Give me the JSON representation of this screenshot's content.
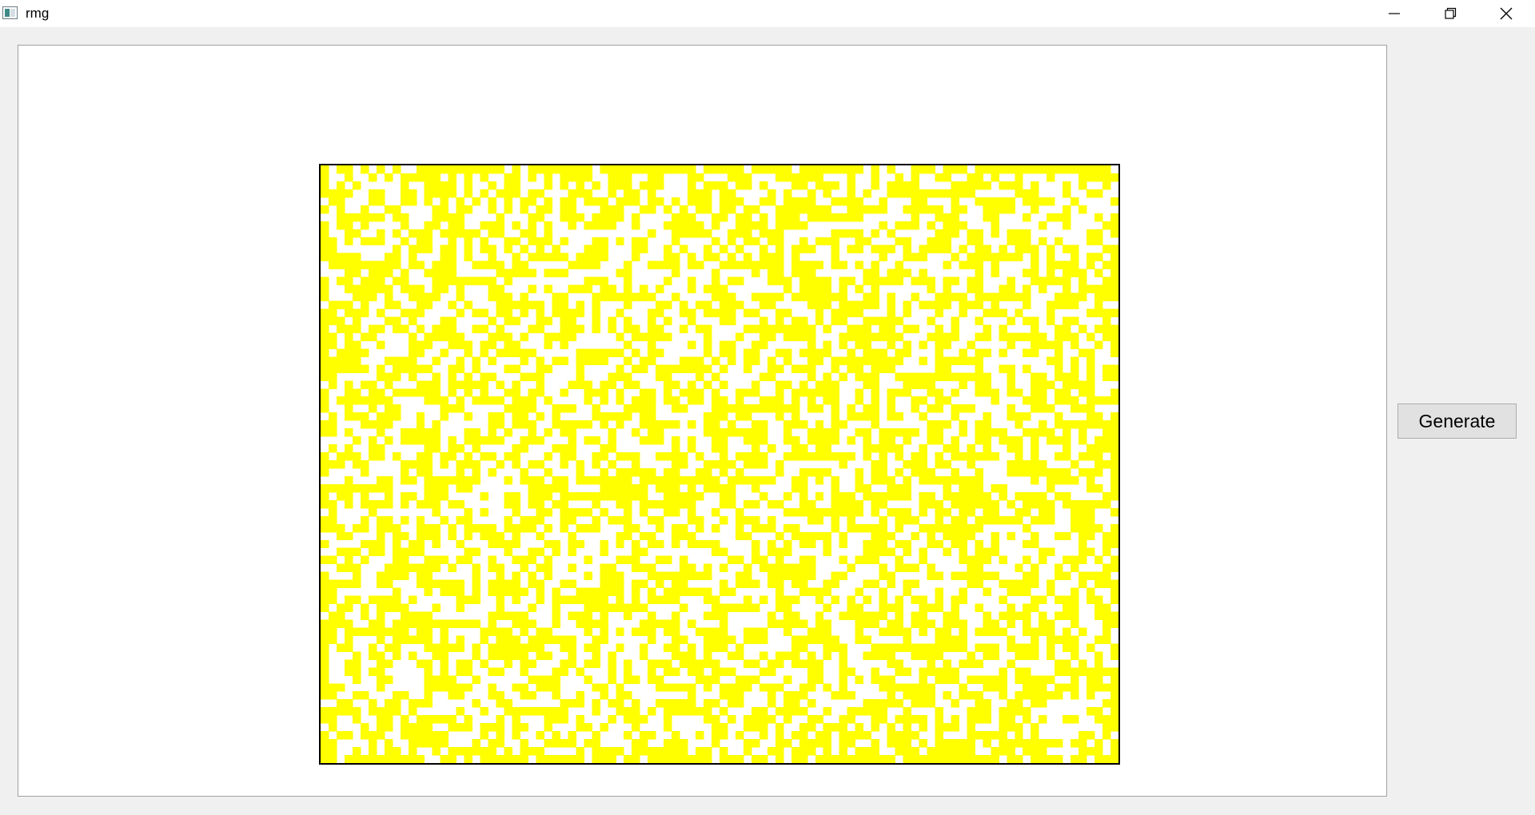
{
  "window": {
    "title": "rmg",
    "icon": "app-window-icon",
    "controls": [
      "minimize-icon",
      "restore-icon",
      "close-icon"
    ]
  },
  "toolbar": {
    "generate_label": "Generate"
  },
  "maze": {
    "columns": 100,
    "rows": 75,
    "wall_color": "#ffff00",
    "open_color": "#ffffff",
    "border_color": "#000000",
    "wall_density": 0.52
  },
  "colors": {
    "background": "#f0f0f0",
    "canvas": "#ffffff",
    "button": "#e1e1e1"
  }
}
